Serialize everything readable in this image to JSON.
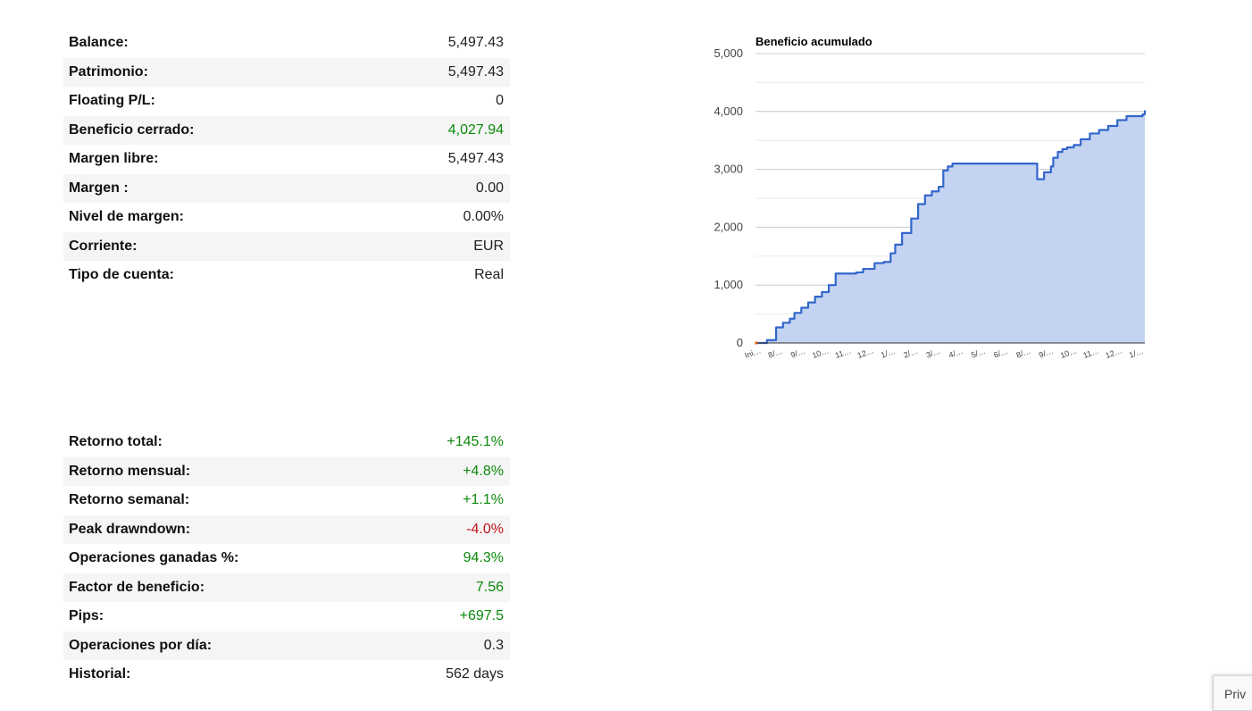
{
  "account": [
    {
      "label": "Balance:",
      "value": "5,497.43",
      "tone": "neutral"
    },
    {
      "label": "Patrimonio:",
      "value": "5,497.43",
      "tone": "neutral"
    },
    {
      "label": "Floating P/L:",
      "value": "0",
      "tone": "neutral"
    },
    {
      "label": "Beneficio cerrado:",
      "value": "4,027.94",
      "tone": "pos"
    },
    {
      "label": "Margen libre:",
      "value": "5,497.43",
      "tone": "neutral"
    },
    {
      "label": "Margen :",
      "value": "0.00",
      "tone": "neutral"
    },
    {
      "label": "Nivel de margen:",
      "value": "0.00%",
      "tone": "neutral"
    },
    {
      "label": "Corriente:",
      "value": "EUR",
      "tone": "neutral"
    },
    {
      "label": "Tipo de cuenta:",
      "value": "Real",
      "tone": "neutral"
    }
  ],
  "performance": [
    {
      "label": "Retorno total:",
      "value": "+145.1%",
      "tone": "pos"
    },
    {
      "label": "Retorno mensual:",
      "value": "+4.8%",
      "tone": "pos"
    },
    {
      "label": "Retorno semanal:",
      "value": "+1.1%",
      "tone": "pos"
    },
    {
      "label": "Peak drawndown:",
      "value": "-4.0%",
      "tone": "neg"
    },
    {
      "label": "Operaciones ganadas %:",
      "value": "94.3%",
      "tone": "pos"
    },
    {
      "label": "Factor de beneficio:",
      "value": "7.56",
      "tone": "pos"
    },
    {
      "label": "Pips:",
      "value": "+697.5",
      "tone": "pos"
    },
    {
      "label": "Operaciones por día:",
      "value": "0.3",
      "tone": "neutral"
    },
    {
      "label": "Historial:",
      "value": "562 days",
      "tone": "neutral"
    }
  ],
  "privacy_badge": "Priv",
  "chart_data": {
    "type": "area",
    "title": "Beneficio acumulado",
    "xlabel": "",
    "ylabel": "",
    "ylim": [
      0,
      5000
    ],
    "yticks": [
      "0",
      "1,000",
      "2,000",
      "3,000",
      "4,000",
      "5,000"
    ],
    "ytick_values": [
      0,
      1000,
      2000,
      3000,
      4000,
      5000
    ],
    "grid": true,
    "x_tick_labels": [
      "Ini…",
      "8/…",
      "9/…",
      "10…",
      "11…",
      "12…",
      "1/…",
      "2/…",
      "3/…",
      "4/…",
      "5/…",
      "6/…",
      "8/…",
      "9/…",
      "10…",
      "11…",
      "12…",
      "1/…"
    ],
    "line_color": "#3366cc",
    "fill_color": "#c3d3f1",
    "series": [
      {
        "x": [
          0,
          0.5,
          0.9,
          1.2,
          1.5,
          1.7,
          2.0,
          2.3,
          2.6,
          2.9,
          3.2,
          3.5,
          3.8,
          4.1,
          4.4,
          4.7,
          5.2,
          5.6,
          5.9,
          6.1,
          6.4,
          6.8,
          7.1,
          7.4,
          7.7,
          8.0,
          8.2,
          8.4,
          8.6,
          8.8,
          9.0,
          9.2,
          9.4,
          9.7,
          10.0,
          10.5,
          11.0,
          11.5,
          12.0,
          12.3,
          12.6,
          12.9,
          13.0,
          13.2,
          13.4,
          13.6,
          13.9,
          14.2,
          14.6,
          15.0,
          15.4,
          15.8,
          16.2,
          16.6,
          16.9,
          17.0
        ],
        "y": [
          0,
          50,
          270,
          350,
          420,
          520,
          610,
          700,
          800,
          880,
          1000,
          1200,
          1200,
          1200,
          1220,
          1280,
          1380,
          1400,
          1550,
          1700,
          1900,
          2150,
          2400,
          2550,
          2620,
          2700,
          2980,
          3050,
          3100,
          3100,
          3100,
          3100,
          3100,
          3100,
          3100,
          3100,
          3100,
          3100,
          3100,
          2830,
          2950,
          3050,
          3200,
          3300,
          3350,
          3380,
          3420,
          3520,
          3620,
          3680,
          3750,
          3850,
          3920,
          3920,
          3950,
          4020
        ]
      }
    ]
  }
}
